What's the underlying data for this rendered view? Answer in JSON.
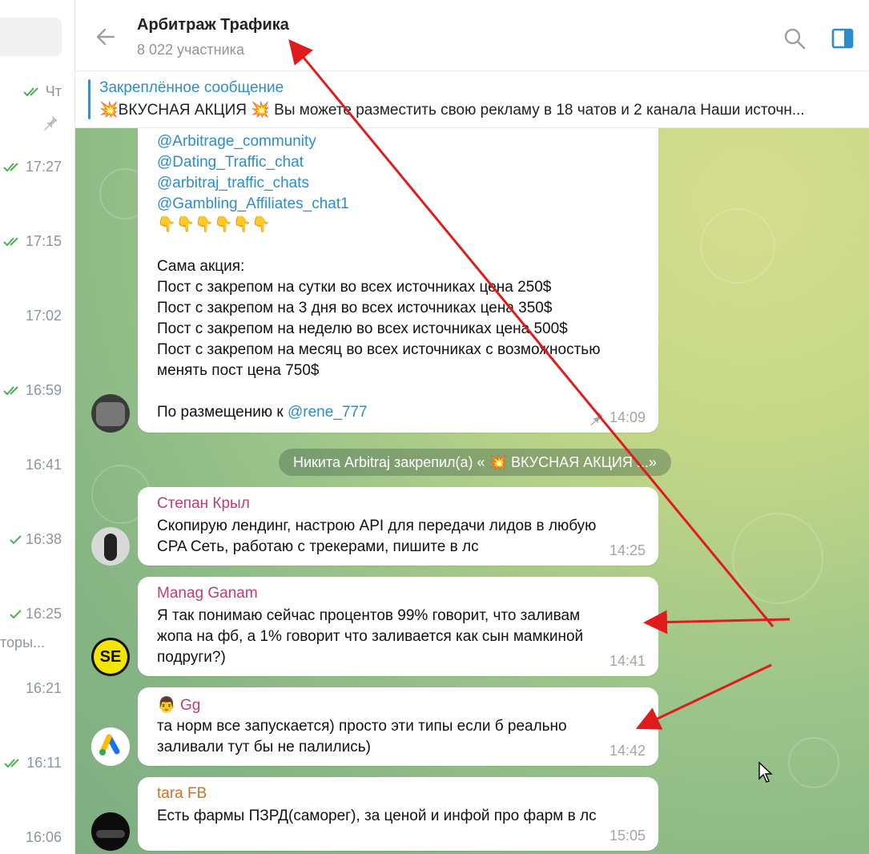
{
  "left_list": {
    "top_time": "Чт",
    "times": [
      "17:27",
      "17:15",
      "17:02",
      "16:59",
      "16:41",
      "16:38",
      "16:25",
      "16:21",
      "16:11",
      "16:06"
    ],
    "snippet": "торы..."
  },
  "header": {
    "title": "Арбитраж Трафика",
    "subtitle": "8 022 участника"
  },
  "pinned": {
    "label": "Закреплённое сообщение",
    "text": "💥ВКУСНАЯ АКЦИЯ 💥 Вы можете разместить свою рекламу в 18 чатов и 2 канала  Наши источн..."
  },
  "messages": {
    "first": {
      "links": [
        "@Arbitrage_community",
        "@Dating_Traffic_chat",
        "@arbitraj_traffic_chats",
        "@Gambling_Affiliates_chat1"
      ],
      "emoji": "👇👇👇👇👇👇",
      "heading": "Сама акция:",
      "lines": [
        "Пост с закрепом на сутки во всех источниках цена 250$",
        "Пост с закрепом на 3 дня во всех источниках цена 350$",
        "Пост с закрепом на неделю во всех источниках цена 500$",
        "Пост с закрепом на месяц во всех источниках с возможностью",
        "менять пост цена 750$"
      ],
      "contact_prefix": "По размещению к ",
      "contact_link": "@rene_777",
      "time": "14:09"
    },
    "service": "Никита Arbitraj закрепил(а) « 💥 ВКУСНАЯ АКЦИЯ ...»",
    "m1": {
      "name": "Степан Крыл",
      "line1": "Скопирую лендинг, настрою API для передачи лидов в любую",
      "line2": "CPA Сеть, работаю с трекерами, пишите в лс",
      "time": "14:25"
    },
    "m2": {
      "name": "Manag Ganam",
      "line1": "Я так понимаю сейчас процентов 99% говорит, что заливам",
      "line2": "жопа на фб, а 1% говорит что заливается как сын мамкиной",
      "line3": "подруги?)",
      "time": "14:41",
      "avatar_text": "SE"
    },
    "m3": {
      "name_emoji": "👨",
      "name": "Gg",
      "line1": "та норм все запускается) просто эти типы если б реально",
      "line2": "заливали тут бы не палились)",
      "time": "14:42"
    },
    "m4": {
      "name": "tara FB",
      "line1": "Есть фармы ПЗРД(саморег), за ценой и инфой про фарм в лс",
      "time": "15:05"
    }
  },
  "colors": {
    "accent": "#2d8dcc",
    "name_pink": "#c03d72",
    "name_orange": "#c8742a",
    "arrow": "#e01b1b"
  }
}
